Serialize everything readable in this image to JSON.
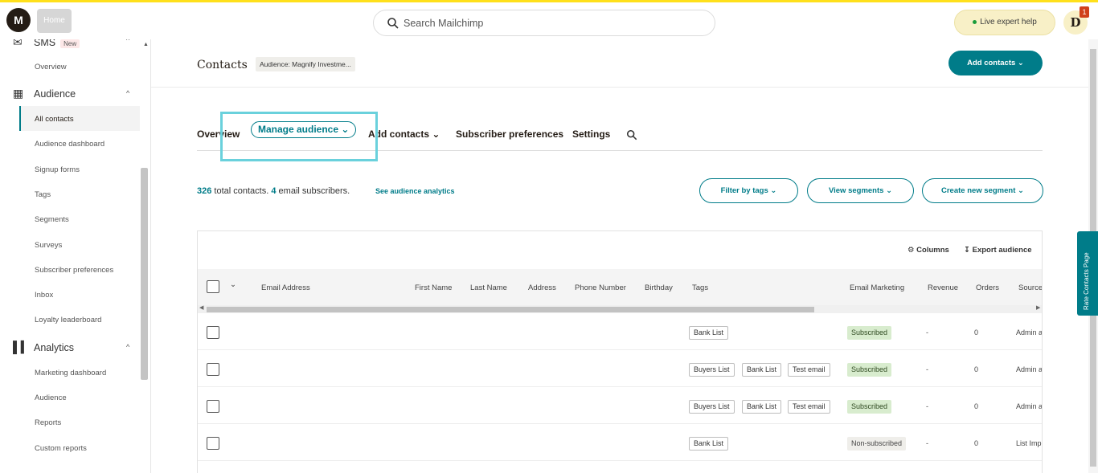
{
  "topbar": {
    "logo_glyph": "M",
    "home_label": "Home",
    "search_placeholder": "Search Mailchimp",
    "expert_help": "Live expert help",
    "avatar_initial": "D",
    "notification_count": "1"
  },
  "sidebar": {
    "sms_label": "SMS",
    "sms_badge": "New",
    "overview": "Overview",
    "audience_section": "Audience",
    "audience_items": [
      "All contacts",
      "Audience dashboard",
      "Signup forms",
      "Tags",
      "Segments",
      "Surveys",
      "Subscriber preferences",
      "Inbox",
      "Loyalty leaderboard"
    ],
    "analytics_section": "Analytics",
    "analytics_items": [
      "Marketing dashboard",
      "Audience",
      "Reports",
      "Custom reports"
    ]
  },
  "header": {
    "title": "Contacts",
    "audience_chip": "Audience: Magnify Investme...",
    "add_contacts": "Add contacts"
  },
  "tabs": {
    "overview": "Overview",
    "manage_audience": "Manage audience",
    "add_contacts": "Add contacts",
    "subscriber_preferences": "Subscriber preferences",
    "settings": "Settings"
  },
  "summary": {
    "total_count": "326",
    "total_text": "total contacts.",
    "email_count": "4",
    "email_text": "email subscribers.",
    "analytics_link": "See audience analytics"
  },
  "filters": {
    "filter_by_tags": "Filter by tags",
    "view_segments": "View segments",
    "create_segment": "Create new segment"
  },
  "table": {
    "tools": {
      "columns": "Columns",
      "export": "Export audience"
    },
    "columns": [
      "Email Address",
      "First Name",
      "Last Name",
      "Address",
      "Phone Number",
      "Birthday",
      "Tags",
      "Email Marketing",
      "Revenue",
      "Orders",
      "Source"
    ],
    "rows": [
      {
        "tags": [
          "Bank List"
        ],
        "email_marketing": "Subscribed",
        "revenue": "-",
        "orders": "0",
        "source": "Admin a"
      },
      {
        "tags": [
          "Buyers List",
          "Bank List",
          "Test email"
        ],
        "email_marketing": "Subscribed",
        "revenue": "-",
        "orders": "0",
        "source": "Admin a"
      },
      {
        "tags": [
          "Buyers List",
          "Bank List",
          "Test email"
        ],
        "email_marketing": "Subscribed",
        "revenue": "-",
        "orders": "0",
        "source": "Admin a"
      },
      {
        "tags": [
          "Bank List"
        ],
        "email_marketing": "Non-subscribed",
        "revenue": "-",
        "orders": "0",
        "source": "List Imp"
      }
    ]
  },
  "feedback_tab": "Rate Contacts Page",
  "colors": {
    "brand_teal": "#007c89",
    "highlight": "#6ad1dc",
    "subscribed_bg": "#d8ecce"
  }
}
